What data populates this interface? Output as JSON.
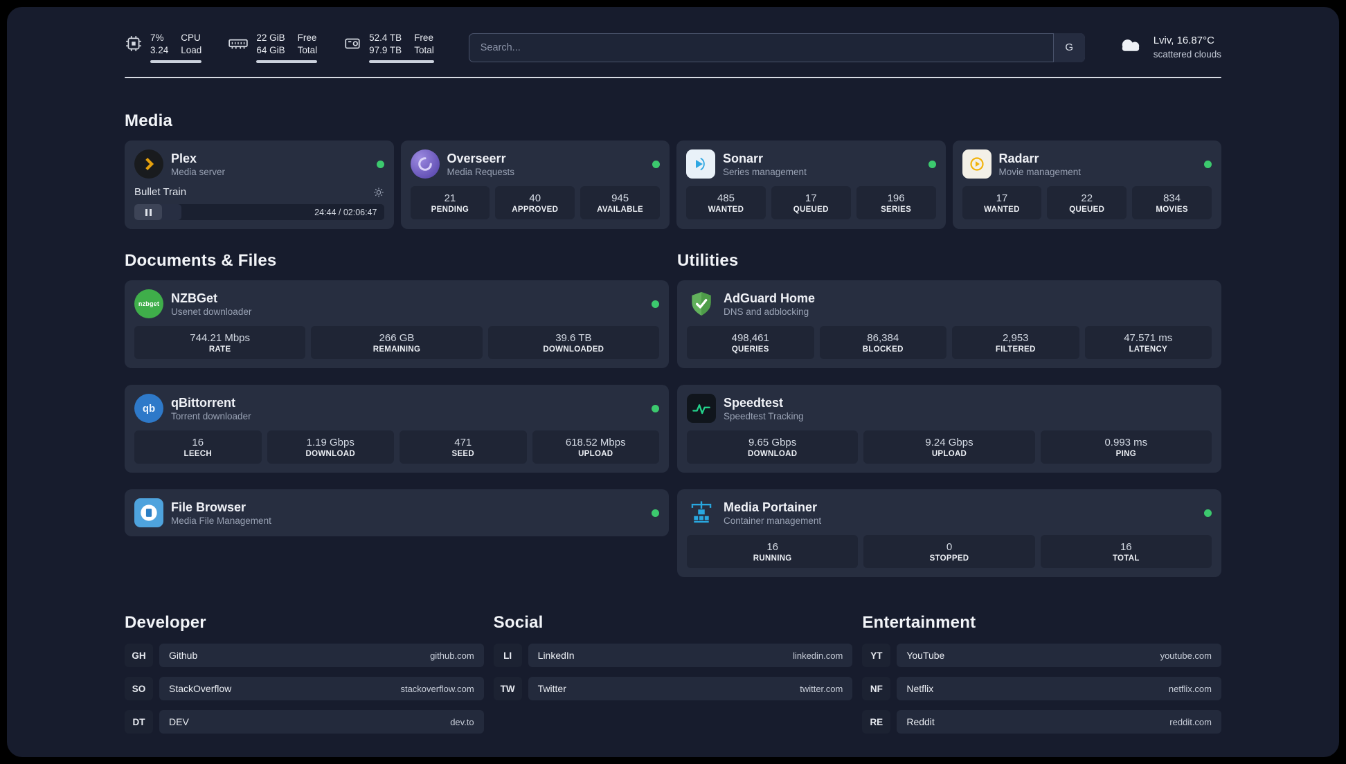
{
  "topbar": {
    "cpu": {
      "value_top": "7%",
      "value_bottom": "3.24",
      "label_top": "CPU",
      "label_bottom": "Load"
    },
    "memory": {
      "value_top": "22 GiB",
      "value_bottom": "64 GiB",
      "label_top": "Free",
      "label_bottom": "Total"
    },
    "disk": {
      "value_top": "52.4 TB",
      "value_bottom": "97.9 TB",
      "label_top": "Free",
      "label_bottom": "Total"
    },
    "search": {
      "placeholder": "Search...",
      "engine_badge": "G"
    },
    "weather": {
      "location": "Lviv, 16.87°C",
      "condition": "scattered clouds"
    }
  },
  "media": {
    "section_title": "Media",
    "plex": {
      "name": "Plex",
      "desc": "Media server",
      "now_playing": "Bullet Train",
      "timestamp": "24:44 / 02:06:47"
    },
    "overseerr": {
      "name": "Overseerr",
      "desc": "Media Requests",
      "stats": [
        {
          "value": "21",
          "label": "PENDING"
        },
        {
          "value": "40",
          "label": "APPROVED"
        },
        {
          "value": "945",
          "label": "AVAILABLE"
        }
      ]
    },
    "sonarr": {
      "name": "Sonarr",
      "desc": "Series management",
      "stats": [
        {
          "value": "485",
          "label": "WANTED"
        },
        {
          "value": "17",
          "label": "QUEUED"
        },
        {
          "value": "196",
          "label": "SERIES"
        }
      ]
    },
    "radarr": {
      "name": "Radarr",
      "desc": "Movie management",
      "stats": [
        {
          "value": "17",
          "label": "WANTED"
        },
        {
          "value": "22",
          "label": "QUEUED"
        },
        {
          "value": "834",
          "label": "MOVIES"
        }
      ]
    }
  },
  "documents": {
    "section_title": "Documents & Files",
    "nzbget": {
      "name": "NZBGet",
      "desc": "Usenet downloader",
      "icon_text": "nzbget",
      "stats": [
        {
          "value": "744.21 Mbps",
          "label": "RATE"
        },
        {
          "value": "266 GB",
          "label": "REMAINING"
        },
        {
          "value": "39.6 TB",
          "label": "DOWNLOADED"
        }
      ]
    },
    "qbittorrent": {
      "name": "qBittorrent",
      "desc": "Torrent downloader",
      "icon_text": "qb",
      "stats": [
        {
          "value": "16",
          "label": "LEECH"
        },
        {
          "value": "1.19 Gbps",
          "label": "DOWNLOAD"
        },
        {
          "value": "471",
          "label": "SEED"
        },
        {
          "value": "618.52 Mbps",
          "label": "UPLOAD"
        }
      ]
    },
    "filebrowser": {
      "name": "File Browser",
      "desc": "Media File Management"
    }
  },
  "utilities": {
    "section_title": "Utilities",
    "adguard": {
      "name": "AdGuard Home",
      "desc": "DNS and adblocking",
      "stats": [
        {
          "value": "498,461",
          "label": "QUERIES"
        },
        {
          "value": "86,384",
          "label": "BLOCKED"
        },
        {
          "value": "2,953",
          "label": "FILTERED"
        },
        {
          "value": "47.571 ms",
          "label": "LATENCY"
        }
      ]
    },
    "speedtest": {
      "name": "Speedtest",
      "desc": "Speedtest Tracking",
      "stats": [
        {
          "value": "9.65 Gbps",
          "label": "DOWNLOAD"
        },
        {
          "value": "9.24 Gbps",
          "label": "UPLOAD"
        },
        {
          "value": "0.993 ms",
          "label": "PING"
        }
      ]
    },
    "portainer": {
      "name": "Media Portainer",
      "desc": "Container management",
      "stats": [
        {
          "value": "16",
          "label": "RUNNING"
        },
        {
          "value": "0",
          "label": "STOPPED"
        },
        {
          "value": "16",
          "label": "TOTAL"
        }
      ]
    }
  },
  "bookmarks": {
    "developer": {
      "section_title": "Developer",
      "items": [
        {
          "abbr": "GH",
          "name": "Github",
          "url": "github.com"
        },
        {
          "abbr": "SO",
          "name": "StackOverflow",
          "url": "stackoverflow.com"
        },
        {
          "abbr": "DT",
          "name": "DEV",
          "url": "dev.to"
        }
      ]
    },
    "social": {
      "section_title": "Social",
      "items": [
        {
          "abbr": "LI",
          "name": "LinkedIn",
          "url": "linkedin.com"
        },
        {
          "abbr": "TW",
          "name": "Twitter",
          "url": "twitter.com"
        }
      ]
    },
    "entertainment": {
      "section_title": "Entertainment",
      "items": [
        {
          "abbr": "YT",
          "name": "YouTube",
          "url": "youtube.com"
        },
        {
          "abbr": "NF",
          "name": "Netflix",
          "url": "netflix.com"
        },
        {
          "abbr": "RE",
          "name": "Reddit",
          "url": "reddit.com"
        }
      ]
    }
  },
  "colors": {
    "status_online": "#3cc96e",
    "plex_amber": "#e5a00d",
    "overseerr_purple": "#4f3da6",
    "sonarr_blue": "#2fa7e2",
    "radarr_yellow": "#f2b30b",
    "nzbget_green": "#3fae4a",
    "qbittorrent_blue": "#2e79c9",
    "adguard_green": "#62b15c",
    "speedtest_green": "#23d18b",
    "portainer_blue": "#29a8e0",
    "filebrowser_blue": "#4ea3dd"
  }
}
